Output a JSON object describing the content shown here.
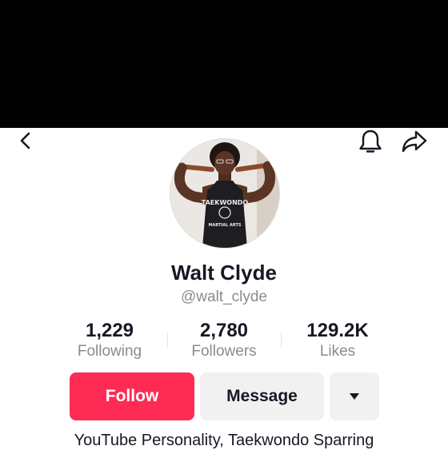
{
  "icons": {
    "back": "chevron-left-icon",
    "notifications": "bell-icon",
    "share": "share-arrow-icon",
    "more": "caret-down-icon"
  },
  "profile": {
    "display_name": "Walt Clyde",
    "handle": "@walt_clyde",
    "bio": "YouTube Personality, Taekwondo Sparring",
    "avatar_shirt_text": "TAEKWONDO",
    "avatar_shirt_subtext": "MARTIAL ARTS"
  },
  "stats": [
    {
      "value": "1,229",
      "label": "Following"
    },
    {
      "value": "2,780",
      "label": "Followers"
    },
    {
      "value": "129.2K",
      "label": "Likes"
    }
  ],
  "actions": {
    "follow": "Follow",
    "message": "Message"
  },
  "colors": {
    "accent": "#fe2c55",
    "secondary_button": "#f1f1f2",
    "muted_text": "#8a8b91",
    "primary_text": "#161823"
  }
}
